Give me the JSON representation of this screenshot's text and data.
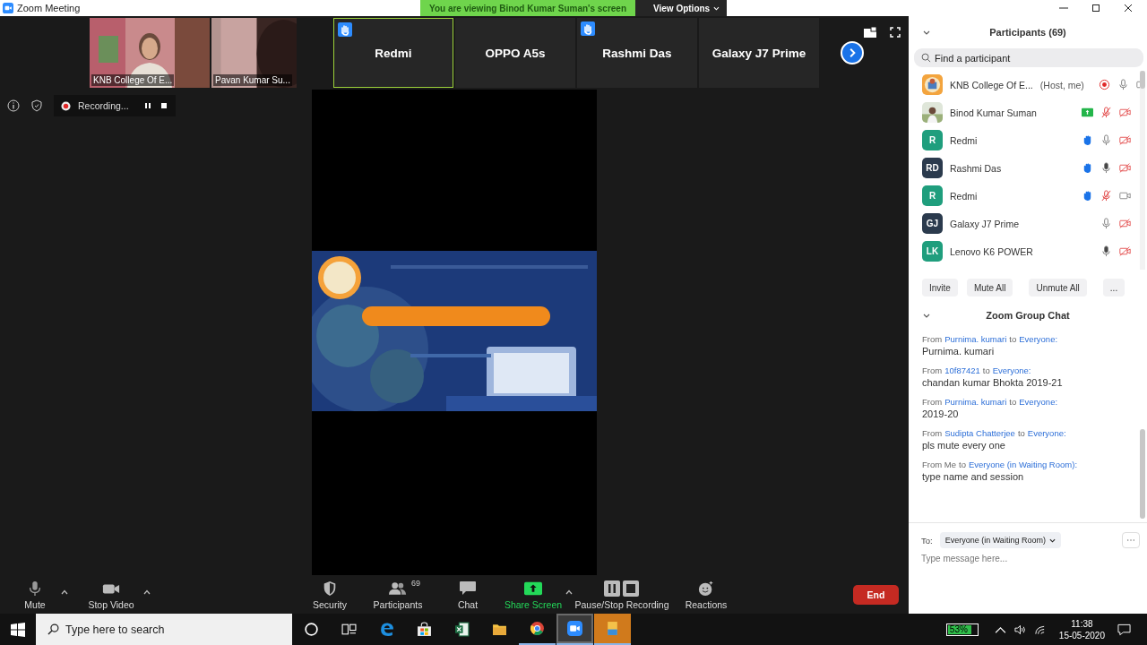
{
  "window": {
    "title": "Zoom Meeting"
  },
  "share_banner": {
    "text": "You are viewing Binod Kumar Suman's screen",
    "view_options": "View Options"
  },
  "tiles": [
    {
      "kind": "video",
      "name": "KNB College Of E...",
      "hand_raised": false,
      "active": false
    },
    {
      "kind": "video",
      "name": "Pavan Kumar Su...",
      "hand_raised": false,
      "active": false
    },
    {
      "kind": "name",
      "name": "Redmi",
      "hand_raised": true,
      "active": true
    },
    {
      "kind": "name",
      "name": "OPPO A5s",
      "hand_raised": false,
      "active": false
    },
    {
      "kind": "name",
      "name": "Rashmi Das",
      "hand_raised": true,
      "active": false
    },
    {
      "kind": "name",
      "name": "Galaxy J7 Prime",
      "hand_raised": false,
      "active": false
    }
  ],
  "recording": {
    "label": "Recording..."
  },
  "toolbar": [
    {
      "kind": "mic",
      "label": "Mute",
      "caret": true
    },
    {
      "kind": "video",
      "label": "Stop Video",
      "caret": true
    },
    {
      "kind": "security",
      "label": "Security",
      "caret": false
    },
    {
      "kind": "participants",
      "label": "Participants",
      "count": "69",
      "caret": false
    },
    {
      "kind": "chat",
      "label": "Chat",
      "caret": false
    },
    {
      "kind": "share",
      "label": "Share Screen",
      "caret": true
    },
    {
      "kind": "record",
      "label": "Pause/Stop Recording",
      "caret": false
    },
    {
      "kind": "reactions",
      "label": "Reactions",
      "caret": false
    }
  ],
  "end_button": "End",
  "participants": {
    "title": "Participants (69)",
    "search_placeholder": "Find a participant",
    "people": [
      {
        "kind": "logo",
        "name": "KNB College Of E...",
        "role": "(Host, me)",
        "recording": true,
        "sharing": false,
        "hand_raised": false,
        "muted": false,
        "speaking": false,
        "video_off": false
      },
      {
        "name": "Binod Kumar Suman",
        "recording": false,
        "sharing": true,
        "hand_raised": false,
        "muted": true,
        "speaking": false,
        "video_off": true
      },
      {
        "kind": "initials",
        "initials": "R",
        "color": "#1f9e7d",
        "name": "Redmi",
        "recording": false,
        "sharing": false,
        "hand_raised": true,
        "muted": false,
        "speaking": false,
        "video_off": true
      },
      {
        "kind": "initials",
        "initials": "RD",
        "color": "#2b3a4d",
        "name": "Rashmi Das",
        "recording": false,
        "sharing": false,
        "hand_raised": true,
        "muted": false,
        "speaking": true,
        "video_off": true
      },
      {
        "kind": "initials",
        "initials": "R",
        "color": "#1f9e7d",
        "name": "Redmi",
        "recording": false,
        "sharing": false,
        "hand_raised": true,
        "muted": true,
        "speaking": false,
        "video_off": false
      },
      {
        "kind": "initials",
        "initials": "GJ",
        "color": "#2b3a4d",
        "name": "Galaxy J7 Prime",
        "recording": false,
        "sharing": false,
        "hand_raised": false,
        "muted": false,
        "speaking": false,
        "video_off": true
      },
      {
        "kind": "initials",
        "initials": "LK",
        "color": "#1f9e7d",
        "name": "Lenovo K6 POWER",
        "recording": false,
        "sharing": false,
        "hand_raised": false,
        "muted": false,
        "speaking": true,
        "video_off": true
      }
    ],
    "actions": [
      "Invite",
      "Mute All",
      "Unmute All",
      "..."
    ]
  },
  "chat": {
    "title": "Zoom Group Chat",
    "messages": [
      {
        "from_word": "From",
        "from": "Purnima. kumari",
        "to_word": "to",
        "to": "Everyone:",
        "text": "Purnima. kumari"
      },
      {
        "from_word": "From",
        "from": "10f87421",
        "to_word": "to",
        "to": "Everyone:",
        "text": "chandan kumar Bhokta 2019-21"
      },
      {
        "from_word": "From",
        "from": "Purnima. kumari",
        "to_word": "to",
        "to": "Everyone:",
        "text": "2019-20"
      },
      {
        "from_word": "From",
        "from": "Sudipta Chatterjee",
        "to_word": "to",
        "to": "Everyone:",
        "text": "pls mute every one"
      },
      {
        "from_word": "From Me",
        "to_word": "to",
        "to": "Everyone (in Waiting Room):",
        "text": "type name and session"
      }
    ],
    "to_label": "To:",
    "recipient": "Everyone (in Waiting Room)",
    "placeholder": "Type message here..."
  },
  "taskbar": {
    "search_placeholder": "Type here to search",
    "apps": [
      {
        "kind": "cortana",
        "open": false,
        "selected": false,
        "flashing": false
      },
      {
        "kind": "taskview",
        "open": false,
        "selected": false,
        "flashing": false
      },
      {
        "kind": "edge",
        "open": false,
        "selected": false,
        "flashing": false
      },
      {
        "kind": "store",
        "open": false,
        "selected": false,
        "flashing": false
      },
      {
        "kind": "excel",
        "open": false,
        "selected": false,
        "flashing": false
      },
      {
        "kind": "explorer",
        "open": false,
        "selected": false,
        "flashing": false
      },
      {
        "kind": "chrome",
        "open": true,
        "selected": false,
        "flashing": false
      },
      {
        "kind": "zoom",
        "open": true,
        "selected": true,
        "flashing": false
      },
      {
        "kind": "files",
        "open": true,
        "selected": false,
        "flashing": true
      }
    ],
    "battery": "53%",
    "time": "11:38",
    "date": "15-05-2020"
  }
}
